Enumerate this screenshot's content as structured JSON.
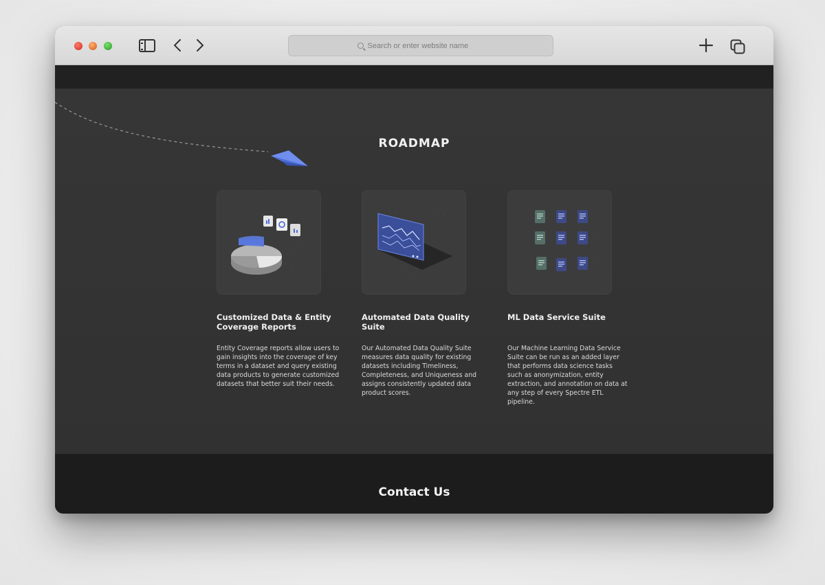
{
  "browser": {
    "url_placeholder": "Search or enter website name"
  },
  "roadmap": {
    "title": "ROADMAP",
    "cards": [
      {
        "title": "Customized Data & Entity Coverage Reports",
        "description": "Entity Coverage reports allow users to gain insights into the coverage of key terms in a dataset and query existing data products to generate customized datasets that better suit their needs."
      },
      {
        "title": "Automated Data Quality Suite",
        "description": "Our Automated Data Quality Suite measures data quality for existing datasets including Timeliness, Completeness, and Uniqueness and assigns consistently updated data product scores."
      },
      {
        "title": "ML Data Service Suite",
        "description": "Our Machine Learning Data Service Suite can be run as an added layer that performs data science tasks such as anonymization, entity extraction, and annotation on data at any step of every Spectre ETL pipeline."
      }
    ]
  },
  "footer": {
    "title": "Contact Us"
  },
  "colors": {
    "accent_blue": "#4f6fd8",
    "section_bg": "#333333",
    "footer_bg": "#1c1c1c"
  }
}
